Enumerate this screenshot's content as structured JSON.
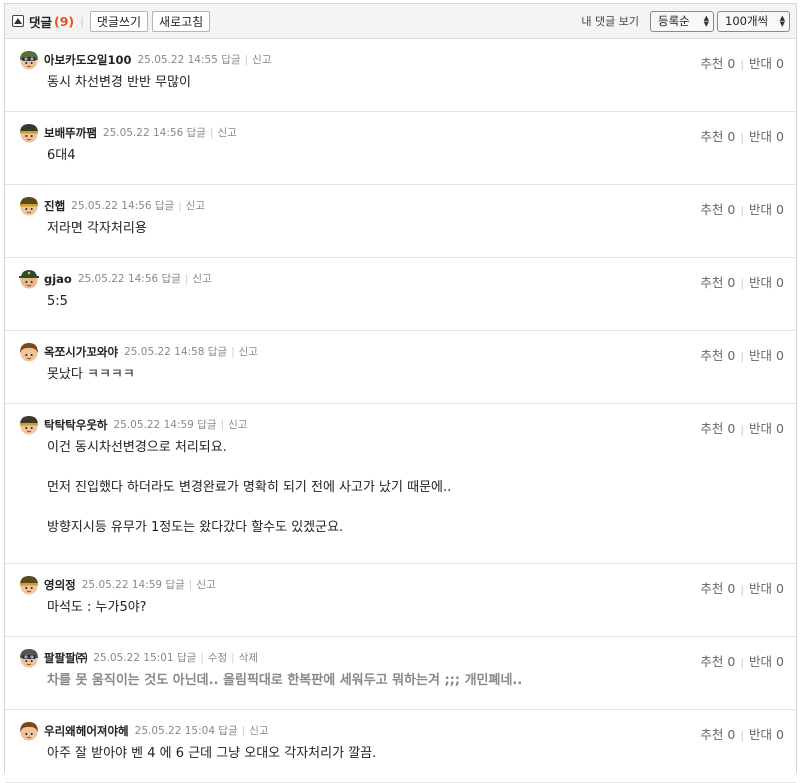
{
  "toolbar": {
    "title": "댓글",
    "count": "(9)",
    "write_label": "댓글쓰기",
    "refresh_label": "새로고침",
    "my_comments": "내 댓글 보기",
    "sort_selected": "등록순",
    "per_page_selected": "100개씩"
  },
  "labels": {
    "reply": "답글",
    "report": "신고",
    "edit": "수정",
    "delete": "삭제",
    "recommend": "추천",
    "oppose": "반대"
  },
  "comments": [
    {
      "nick": "아보카도오일100",
      "date": "25.05.22 14:55",
      "up": "0",
      "down": "0",
      "lines": [
        "동시 차선변경 반반 무많이"
      ],
      "avatar": {
        "skin": "#f0c49a",
        "hat": "#5e6b3a",
        "style": "goggle"
      }
    },
    {
      "nick": "보배뚜까팸",
      "date": "25.05.22 14:56",
      "up": "0",
      "down": "0",
      "lines": [
        "6대4"
      ],
      "avatar": {
        "skin": "#f0c49a",
        "hat": "#3a3a2a",
        "style": "helmet"
      }
    },
    {
      "nick": "진햅",
      "date": "25.05.22 14:56",
      "up": "0",
      "down": "0",
      "lines": [
        "저라면 각자처리용"
      ],
      "avatar": {
        "skin": "#f0c49a",
        "hat": "#5a4a1a",
        "style": "helmet"
      }
    },
    {
      "nick": "gjao",
      "date": "25.05.22 14:56",
      "up": "0",
      "down": "0",
      "lines": [
        "5:5"
      ],
      "avatar": {
        "skin": "#e8b88a",
        "hat": "#2f4a2a",
        "style": "cap"
      }
    },
    {
      "nick": "옥쪼시가꼬와야",
      "date": "25.05.22 14:58",
      "up": "0",
      "down": "0",
      "lines": [
        "못났다 ㅋㅋㅋㅋ"
      ],
      "avatar": {
        "skin": "#f0c49a",
        "hat": "#7a4a1a",
        "style": "hair"
      }
    },
    {
      "nick": "탁탁탁우웃하",
      "date": "25.05.22 14:59",
      "up": "0",
      "down": "0",
      "lines": [
        "이건 동시차선변경으로 처리되요.",
        "",
        "먼저 진입했다 하더라도 변경완료가 명확히 되기 전에 사고가 났기 때문에..",
        "",
        "방향지시등 유무가 1정도는 왔다갔다 할수도 있겠군요."
      ],
      "avatar": {
        "skin": "#f0c49a",
        "hat": "#3a3a2a",
        "style": "helmet"
      }
    },
    {
      "nick": "영의정",
      "date": "25.05.22 14:59",
      "up": "0",
      "down": "0",
      "lines": [
        "마석도 : 누가5야?"
      ],
      "avatar": {
        "skin": "#f0c49a",
        "hat": "#5a4a1a",
        "style": "helmet"
      }
    },
    {
      "nick": "팔팔팔㈜",
      "date": "25.05.22 15:01",
      "up": "0",
      "down": "0",
      "own": true,
      "deleted": true,
      "lines": [
        "차를 못 움직이는 것도 아닌데.. 올림픽대로 한복판에 세워두고 뭐하는겨 ;;; 개민폐네.."
      ],
      "avatar": {
        "skin": "#f0c49a",
        "hat": "#555555",
        "style": "goggle"
      }
    },
    {
      "nick": "우리왜헤어져야헤",
      "date": "25.05.22 15:04",
      "up": "0",
      "down": "0",
      "lines": [
        "아주 잘 받아야 벤 4 에 6 근데 그냥 오대오 각자처리가 깔끔."
      ],
      "avatar": {
        "skin": "#f0c49a",
        "hat": "#7a4a1a",
        "style": "hair"
      }
    }
  ]
}
